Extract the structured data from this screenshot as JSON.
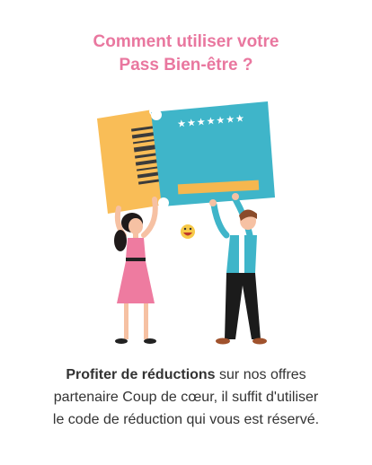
{
  "header": {
    "title_line1": "Comment utiliser votre",
    "title_line2": "Pass Bien-être ?"
  },
  "illustration": {
    "ticket_stars": "★★★★★★★",
    "icons": [
      "ticket-icon",
      "barcode-icon",
      "smiley-emoji-icon",
      "woman-figure",
      "man-figure"
    ],
    "colors": {
      "title": "#e9779f",
      "ticket_main": "#3fb5c9",
      "ticket_stub": "#f9bd57",
      "ticket_bar": "#f5b74f",
      "dress": "#ee7ba0",
      "shirt": "#3fb5c9"
    }
  },
  "body": {
    "highlight": "Profiter de réductions",
    "text_line1_rest": " sur nos offres",
    "text_line2": "partenaire Coup de cœur, il suffit d'utiliser",
    "text_line3": "le code de réduction qui vous est réservé."
  }
}
